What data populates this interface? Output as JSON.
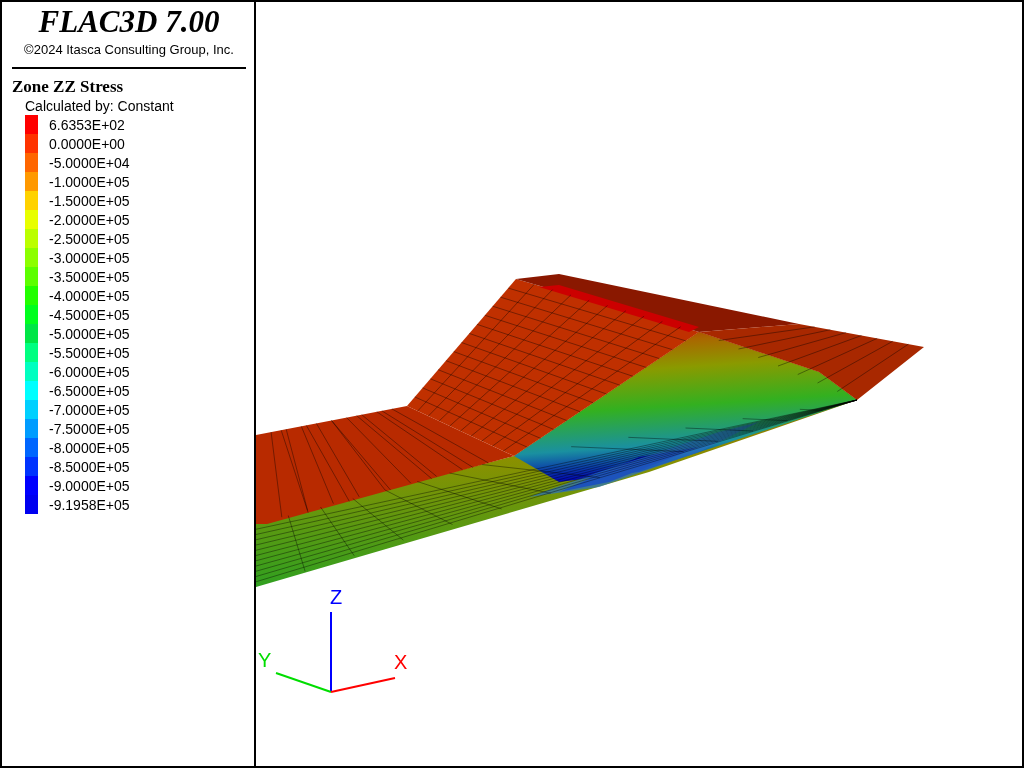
{
  "header": {
    "title": "FLAC3D 7.00",
    "copyright": "©2024 Itasca Consulting Group, Inc."
  },
  "legend": {
    "title": "Zone ZZ Stress",
    "subtitle": "Calculated by: Constant",
    "items": [
      {
        "label": "6.6353E+02",
        "color": "#ff0000"
      },
      {
        "label": "0.0000E+00",
        "color": "#ff3300"
      },
      {
        "label": "-5.0000E+04",
        "color": "#ff6600"
      },
      {
        "label": "-1.0000E+05",
        "color": "#ff9900"
      },
      {
        "label": "-1.5000E+05",
        "color": "#ffd200"
      },
      {
        "label": "-2.0000E+05",
        "color": "#e8ff00"
      },
      {
        "label": "-2.5000E+05",
        "color": "#bbff00"
      },
      {
        "label": "-3.0000E+05",
        "color": "#8cff00"
      },
      {
        "label": "-3.5000E+05",
        "color": "#5cff00"
      },
      {
        "label": "-4.0000E+05",
        "color": "#22ff00"
      },
      {
        "label": "-4.5000E+05",
        "color": "#00ff1e"
      },
      {
        "label": "-5.0000E+05",
        "color": "#00e646"
      },
      {
        "label": "-5.5000E+05",
        "color": "#00ff80"
      },
      {
        "label": "-6.0000E+05",
        "color": "#00ffc0"
      },
      {
        "label": "-6.5000E+05",
        "color": "#00ffff"
      },
      {
        "label": "-7.0000E+05",
        "color": "#00d0ff"
      },
      {
        "label": "-7.5000E+05",
        "color": "#009cff"
      },
      {
        "label": "-8.0000E+05",
        "color": "#0066ff"
      },
      {
        "label": "-8.5000E+05",
        "color": "#0033ff"
      },
      {
        "label": "-9.0000E+05",
        "color": "#0000ff"
      },
      {
        "label": "-9.1958E+05",
        "color": "#0000f0"
      }
    ]
  },
  "axes": {
    "x_label": "X",
    "y_label": "Y",
    "z_label": "Z"
  }
}
